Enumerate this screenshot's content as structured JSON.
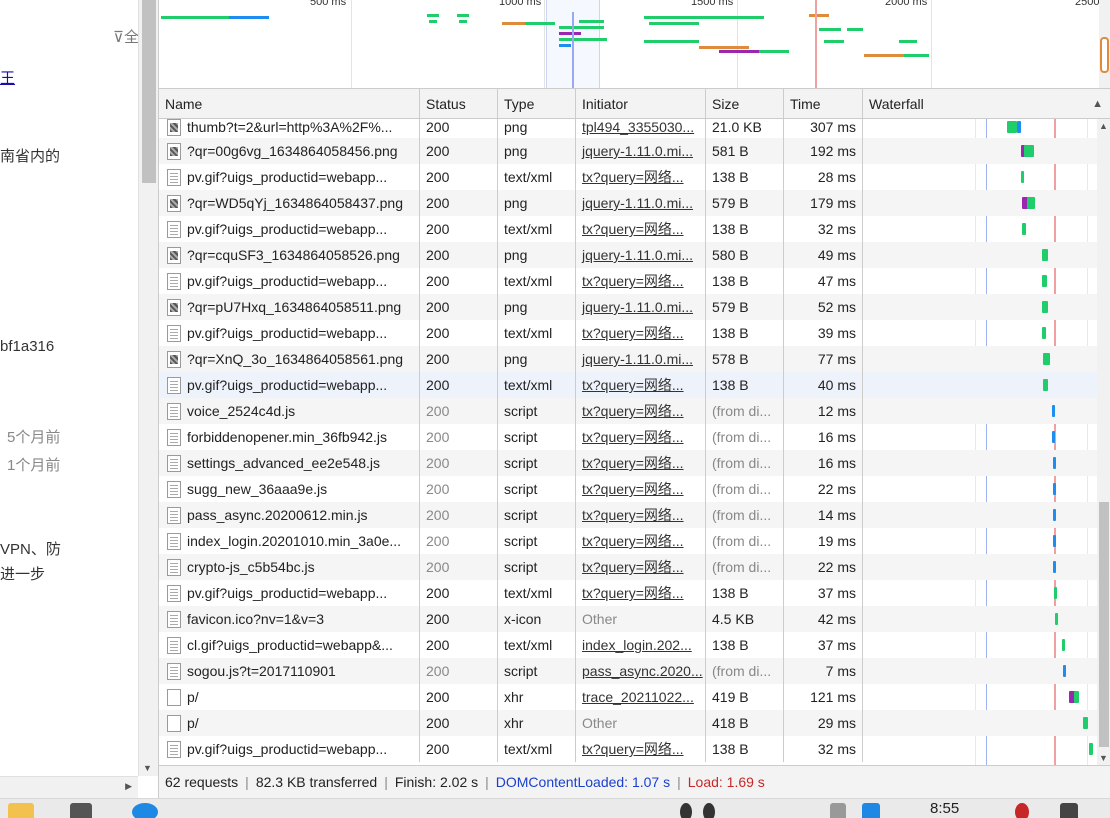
{
  "left_page": {
    "filter_label": "⊽全",
    "fragments": [
      {
        "text": "王",
        "style": "link"
      },
      {
        "text": "南省内的",
        "style": "normal"
      },
      {
        "text": "bf1a316",
        "style": "normal"
      },
      {
        "text": "5个月前",
        "style": "muted"
      },
      {
        "text": "1个月前",
        "style": "muted"
      },
      {
        "text": "VPN、防",
        "style": "normal"
      },
      {
        "text": "进一步",
        "style": "normal"
      }
    ]
  },
  "overview": {
    "tick_labels": [
      "500 ms",
      "1000 ms",
      "1500 ms",
      "2000 ms",
      "2500"
    ]
  },
  "columns": {
    "name": "Name",
    "status": "Status",
    "type": "Type",
    "initiator": "Initiator",
    "size": "Size",
    "time": "Time",
    "waterfall": "Waterfall"
  },
  "requests": [
    {
      "name": "thumb?t=2&url=http%3A%2F%...",
      "icon": "img",
      "status": "200",
      "type": "png",
      "initiator": "tpl494_3355030...",
      "initiator_link": true,
      "size": "21.0 KB",
      "time": "307 ms",
      "wf": [
        {
          "start": 0.615,
          "end": 0.66,
          "color": "#1fcd6b"
        },
        {
          "start": 0.66,
          "end": 0.675,
          "color": "#1d8ef0"
        }
      ]
    },
    {
      "name": "?qr=00g6vg_1634864058456.png",
      "icon": "img",
      "status": "200",
      "type": "png",
      "initiator": "jquery-1.11.0.mi...",
      "initiator_link": true,
      "size": "581 B",
      "time": "192 ms",
      "wf": [
        {
          "start": 0.675,
          "end": 0.72,
          "color": "#9b27b0"
        },
        {
          "start": 0.69,
          "end": 0.73,
          "color": "#1fcd6b"
        }
      ]
    },
    {
      "name": "pv.gif?uigs_productid=webapp...",
      "icon": "doc",
      "status": "200",
      "type": "text/xml",
      "initiator": "tx?query=网络...",
      "initiator_link": true,
      "size": "138 B",
      "time": "28 ms",
      "wf": [
        {
          "start": 0.675,
          "end": 0.688,
          "color": "#1fcd6b"
        }
      ]
    },
    {
      "name": "?qr=WD5qYj_1634864058437.png",
      "icon": "img",
      "status": "200",
      "type": "png",
      "initiator": "jquery-1.11.0.mi...",
      "initiator_link": true,
      "size": "579 B",
      "time": "179 ms",
      "wf": [
        {
          "start": 0.68,
          "end": 0.72,
          "color": "#9b27b0"
        },
        {
          "start": 0.7,
          "end": 0.735,
          "color": "#1fcd6b"
        }
      ]
    },
    {
      "name": "pv.gif?uigs_productid=webapp...",
      "icon": "doc",
      "status": "200",
      "type": "text/xml",
      "initiator": "tx?query=网络...",
      "initiator_link": true,
      "size": "138 B",
      "time": "32 ms",
      "wf": [
        {
          "start": 0.68,
          "end": 0.695,
          "color": "#1fcd6b"
        }
      ]
    },
    {
      "name": "?qr=cquSF3_1634864058526.png",
      "icon": "img",
      "status": "200",
      "type": "png",
      "initiator": "jquery-1.11.0.mi...",
      "initiator_link": true,
      "size": "580 B",
      "time": "49 ms",
      "wf": [
        {
          "start": 0.765,
          "end": 0.79,
          "color": "#1fcd6b"
        }
      ]
    },
    {
      "name": "pv.gif?uigs_productid=webapp...",
      "icon": "doc",
      "status": "200",
      "type": "text/xml",
      "initiator": "tx?query=网络...",
      "initiator_link": true,
      "size": "138 B",
      "time": "47 ms",
      "wf": [
        {
          "start": 0.765,
          "end": 0.785,
          "color": "#1fcd6b"
        }
      ]
    },
    {
      "name": "?qr=pU7Hxq_1634864058511.png",
      "icon": "img",
      "status": "200",
      "type": "png",
      "initiator": "jquery-1.11.0.mi...",
      "initiator_link": true,
      "size": "579 B",
      "time": "52 ms",
      "wf": [
        {
          "start": 0.765,
          "end": 0.79,
          "color": "#1fcd6b"
        }
      ]
    },
    {
      "name": "pv.gif?uigs_productid=webapp...",
      "icon": "doc",
      "status": "200",
      "type": "text/xml",
      "initiator": "tx?query=网络...",
      "initiator_link": true,
      "size": "138 B",
      "time": "39 ms",
      "wf": [
        {
          "start": 0.765,
          "end": 0.783,
          "color": "#1fcd6b"
        }
      ]
    },
    {
      "name": "?qr=XnQ_3o_1634864058561.png",
      "icon": "img",
      "status": "200",
      "type": "png",
      "initiator": "jquery-1.11.0.mi...",
      "initiator_link": true,
      "size": "578 B",
      "time": "77 ms",
      "wf": [
        {
          "start": 0.77,
          "end": 0.8,
          "color": "#1fcd6b"
        }
      ]
    },
    {
      "name": "pv.gif?uigs_productid=webapp...",
      "icon": "doc",
      "status": "200",
      "type": "text/xml",
      "initiator": "tx?query=网络...",
      "initiator_link": true,
      "size": "138 B",
      "time": "40 ms",
      "wf": [
        {
          "start": 0.77,
          "end": 0.79,
          "color": "#1fcd6b"
        }
      ]
    },
    {
      "name": "voice_2524c4d.js",
      "icon": "doc",
      "status": "200",
      "status_dim": true,
      "type": "script",
      "initiator": "tx?query=网络...",
      "initiator_link": true,
      "size": "(from di...",
      "size_dim": true,
      "time": "12 ms",
      "wf": [
        {
          "start": 0.808,
          "end": 0.818,
          "color": "#1d8ef0"
        }
      ]
    },
    {
      "name": "forbiddenopener.min_36fb942.js",
      "icon": "doc",
      "status": "200",
      "status_dim": true,
      "type": "script",
      "initiator": "tx?query=网络...",
      "initiator_link": true,
      "size": "(from di...",
      "size_dim": true,
      "time": "16 ms",
      "wf": [
        {
          "start": 0.808,
          "end": 0.818,
          "color": "#1d8ef0"
        }
      ]
    },
    {
      "name": "settings_advanced_ee2e548.js",
      "icon": "doc",
      "status": "200",
      "status_dim": true,
      "type": "script",
      "initiator": "tx?query=网络...",
      "initiator_link": true,
      "size": "(from di...",
      "size_dim": true,
      "time": "16 ms",
      "wf": [
        {
          "start": 0.81,
          "end": 0.818,
          "color": "#1d8ef0"
        }
      ]
    },
    {
      "name": "sugg_new_36aaa9e.js",
      "icon": "doc",
      "status": "200",
      "status_dim": true,
      "type": "script",
      "initiator": "tx?query=网络...",
      "initiator_link": true,
      "size": "(from di...",
      "size_dim": true,
      "time": "22 ms",
      "wf": [
        {
          "start": 0.81,
          "end": 0.82,
          "color": "#1d8ef0"
        }
      ]
    },
    {
      "name": "pass_async.20200612.min.js",
      "icon": "doc",
      "status": "200",
      "status_dim": true,
      "type": "script",
      "initiator": "tx?query=网络...",
      "initiator_link": true,
      "size": "(from di...",
      "size_dim": true,
      "time": "14 ms",
      "wf": [
        {
          "start": 0.81,
          "end": 0.82,
          "color": "#1d8ef0"
        }
      ]
    },
    {
      "name": "index_login.20201010.min_3a0e...",
      "icon": "doc",
      "status": "200",
      "status_dim": true,
      "type": "script",
      "initiator": "tx?query=网络...",
      "initiator_link": true,
      "size": "(from di...",
      "size_dim": true,
      "time": "19 ms",
      "wf": [
        {
          "start": 0.81,
          "end": 0.82,
          "color": "#1d8ef0"
        }
      ]
    },
    {
      "name": "crypto-js_c5b54bc.js",
      "icon": "doc",
      "status": "200",
      "status_dim": true,
      "type": "script",
      "initiator": "tx?query=网络...",
      "initiator_link": true,
      "size": "(from di...",
      "size_dim": true,
      "time": "22 ms",
      "wf": [
        {
          "start": 0.81,
          "end": 0.822,
          "color": "#1d8ef0"
        }
      ]
    },
    {
      "name": "pv.gif?uigs_productid=webapp...",
      "icon": "doc",
      "status": "200",
      "type": "text/xml",
      "initiator": "tx?query=网络...",
      "initiator_link": true,
      "size": "138 B",
      "time": "37 ms",
      "wf": [
        {
          "start": 0.818,
          "end": 0.83,
          "color": "#1fcd6b"
        }
      ]
    },
    {
      "name": "favicon.ico?nv=1&v=3",
      "icon": "doc",
      "status": "200",
      "type": "x-icon",
      "initiator": "Other",
      "initiator_link": false,
      "size": "4.5 KB",
      "time": "42 ms",
      "wf": [
        {
          "start": 0.82,
          "end": 0.835,
          "color": "#1fcd6b"
        }
      ]
    },
    {
      "name": "cl.gif?uigs_productid=webapp&...",
      "icon": "doc",
      "status": "200",
      "type": "text/xml",
      "initiator": "index_login.202...",
      "initiator_link": true,
      "size": "138 B",
      "time": "37 ms",
      "wf": [
        {
          "start": 0.85,
          "end": 0.862,
          "color": "#1fcd6b"
        }
      ]
    },
    {
      "name": "sogou.js?t=2017110901",
      "icon": "doc",
      "status": "200",
      "status_dim": true,
      "type": "script",
      "initiator": "pass_async.2020...",
      "initiator_link": true,
      "size": "(from di...",
      "size_dim": true,
      "time": "7 ms",
      "wf": [
        {
          "start": 0.855,
          "end": 0.865,
          "color": "#1d8ef0"
        }
      ]
    },
    {
      "name": "p/",
      "icon": "blank",
      "status": "200",
      "type": "xhr",
      "initiator": "trace_20211022...",
      "initiator_link": true,
      "size": "419 B",
      "time": "121 ms",
      "wf": [
        {
          "start": 0.88,
          "end": 0.91,
          "color": "#9b27b0"
        },
        {
          "start": 0.9,
          "end": 0.925,
          "color": "#1fcd6b"
        }
      ]
    },
    {
      "name": "p/",
      "icon": "blank",
      "status": "200",
      "type": "xhr",
      "initiator": "Other",
      "initiator_link": false,
      "size": "418 B",
      "time": "29 ms",
      "wf": [
        {
          "start": 0.94,
          "end": 0.96,
          "color": "#1fcd6b"
        }
      ]
    },
    {
      "name": "pv.gif?uigs_productid=webapp...",
      "icon": "doc",
      "status": "200",
      "type": "text/xml",
      "initiator": "tx?query=网络...",
      "initiator_link": true,
      "size": "138 B",
      "time": "32 ms",
      "wf": [
        {
          "start": 0.965,
          "end": 0.985,
          "color": "#1fcd6b"
        }
      ]
    }
  ],
  "summary": {
    "requests": "62 requests",
    "transferred": "82.3 KB transferred",
    "finish": "Finish: 2.02 s",
    "dom_content_loaded": "DOMContentLoaded: 1.07 s",
    "load": "Load: 1.69 s"
  },
  "taskbar": {
    "clock": "8:55"
  },
  "colors": {
    "waiting": "#1fcd6b",
    "download": "#1d8ef0",
    "queue": "#9b27b0",
    "dcl_line": "#9fb2f0",
    "load_line": "#f0a0a0"
  }
}
